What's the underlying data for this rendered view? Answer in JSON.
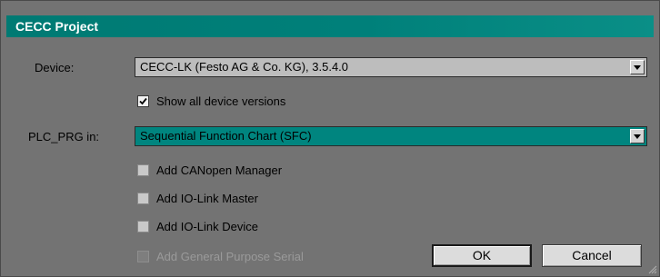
{
  "dialog": {
    "title": "CECC Project"
  },
  "device": {
    "label": "Device:",
    "value": "CECC-LK (Festo AG & Co. KG), 3.5.4.0"
  },
  "show_all_versions": {
    "label": "Show all device versions",
    "checked": true
  },
  "plc_prg": {
    "label": "PLC_PRG in:",
    "value": "Sequential Function Chart (SFC)"
  },
  "options": [
    {
      "label": "Add CANopen Manager",
      "checked": false,
      "enabled": true
    },
    {
      "label": "Add IO-Link Master",
      "checked": false,
      "enabled": true
    },
    {
      "label": "Add IO-Link Device",
      "checked": false,
      "enabled": true
    },
    {
      "label": "Add General Purpose Serial",
      "checked": false,
      "enabled": false
    }
  ],
  "buttons": {
    "ok": "OK",
    "cancel": "Cancel"
  },
  "colors": {
    "titlebar": "#007a73",
    "selection": "#00857f",
    "background": "#737373"
  }
}
